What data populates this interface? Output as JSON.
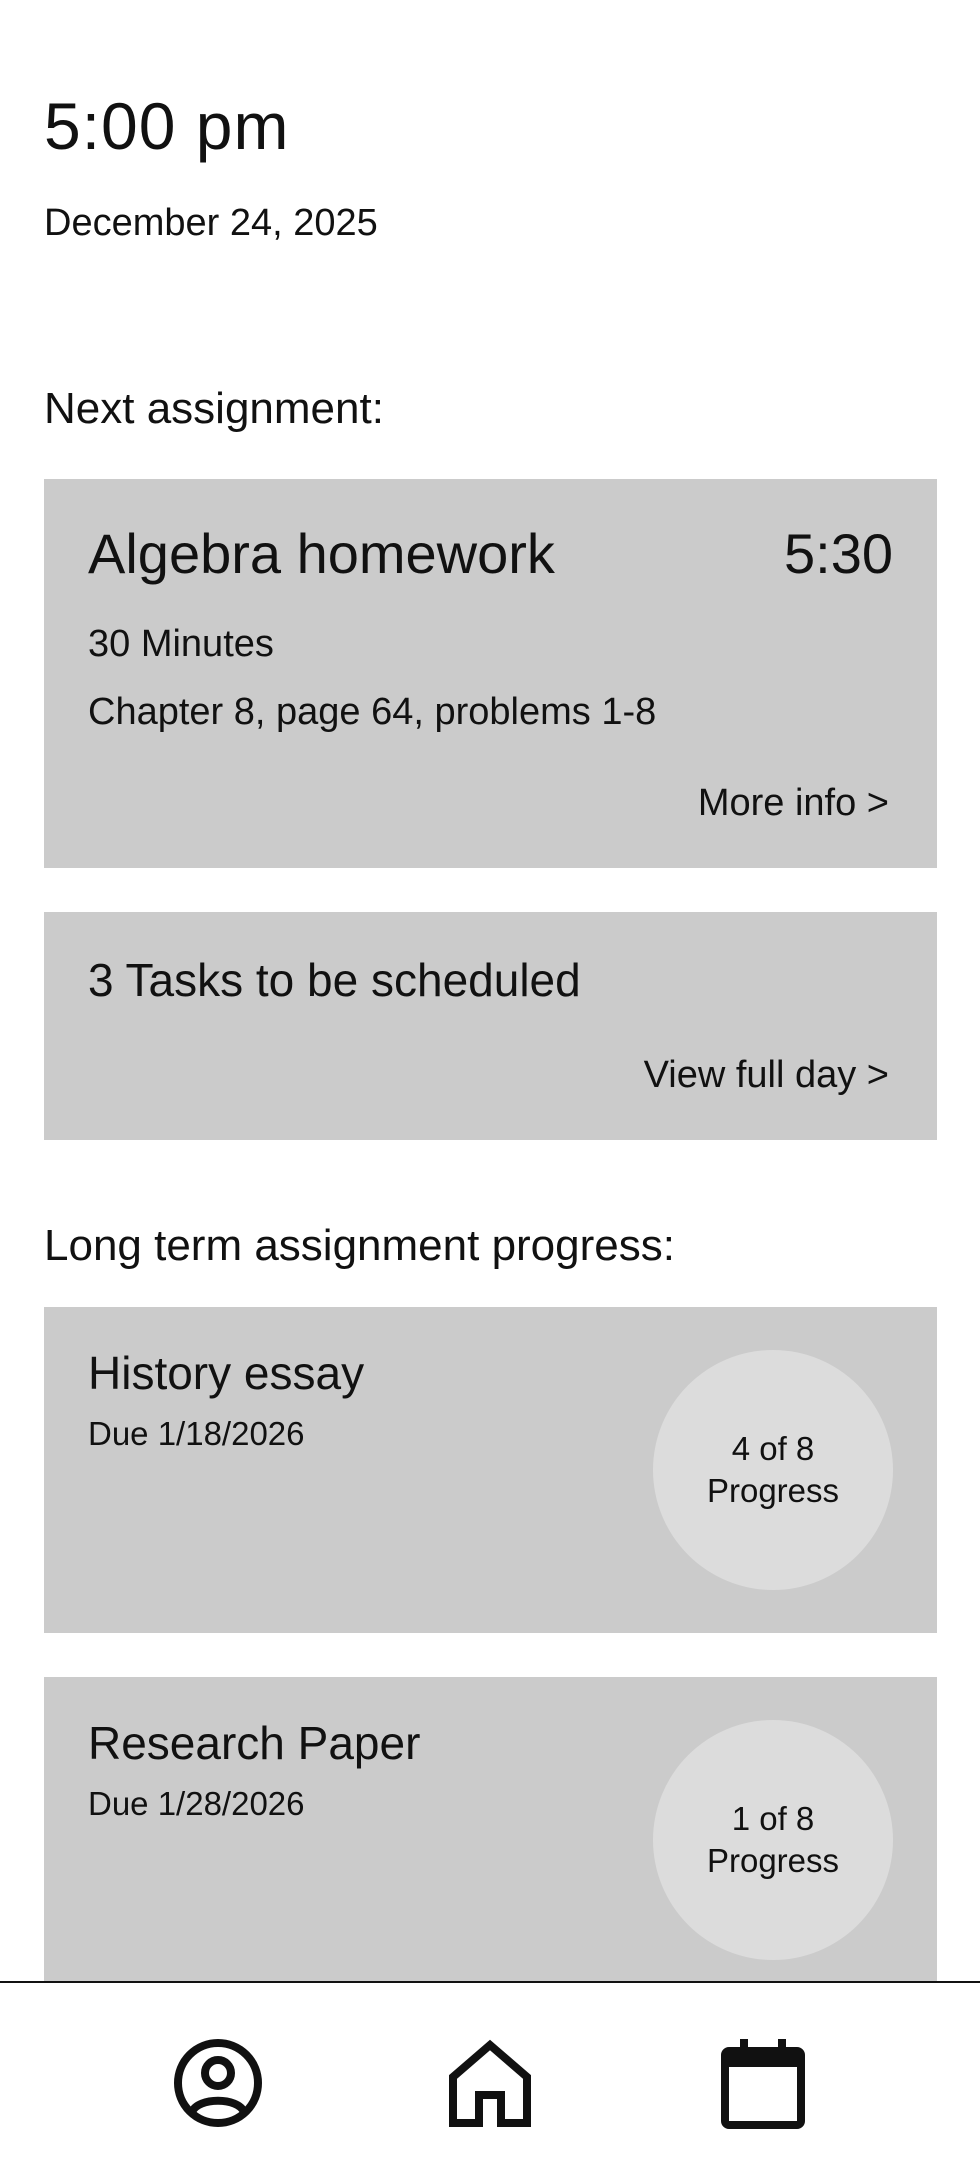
{
  "header": {
    "time": "5:00 pm",
    "date": "December 24, 2025"
  },
  "next_assignment": {
    "section_label": "Next assignment:",
    "title": "Algebra homework",
    "time": "5:30",
    "duration": "30 Minutes",
    "details": "Chapter 8, page 64, problems 1-8",
    "link_label": "More info >"
  },
  "tasks": {
    "summary": "3 Tasks to be scheduled",
    "link_label": "View full day >"
  },
  "long_term": {
    "section_label": "Long term assignment progress:",
    "items": [
      {
        "title": "History essay",
        "due": "Due 1/18/2026",
        "progress_count": "4 of 8",
        "progress_label": "Progress"
      },
      {
        "title": "Research Paper",
        "due": "Due 1/28/2026",
        "progress_count": "1 of 8",
        "progress_label": "Progress"
      }
    ]
  },
  "bottom_nav": {
    "items": [
      {
        "icon": "user-icon"
      },
      {
        "icon": "home-icon"
      },
      {
        "icon": "calendar-icon"
      }
    ]
  },
  "colors": {
    "card_background": "#cbcbcb",
    "progress_circle": "#dcdcdc",
    "text": "#111111"
  }
}
